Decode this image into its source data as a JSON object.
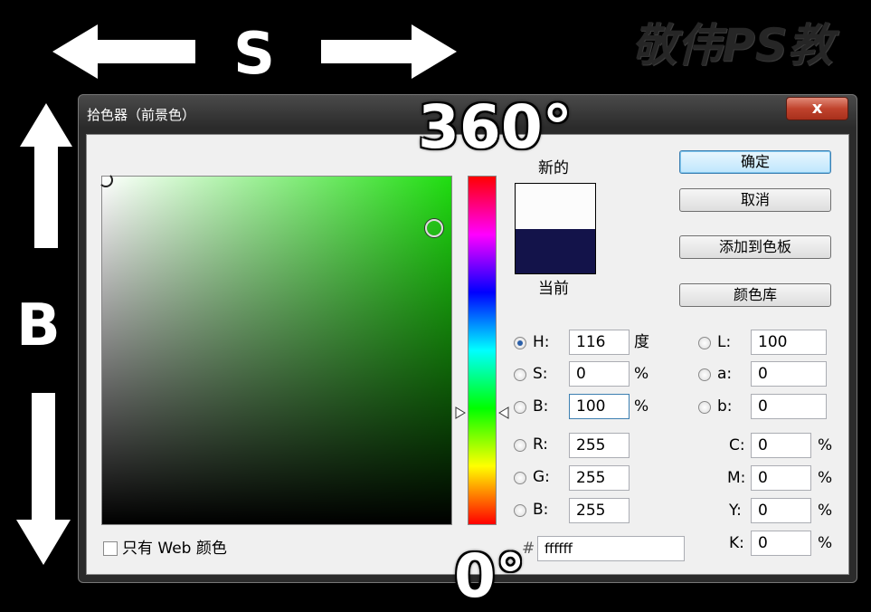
{
  "overlay": {
    "s_label": "S",
    "b_label": "B",
    "hue_top_label": "360°",
    "hue_bottom_label": "0°",
    "watermark": "敬伟PS教"
  },
  "dialog": {
    "title": "拾色器（前景色）",
    "close_label": "x"
  },
  "swatch": {
    "new_label": "新的",
    "current_label": "当前",
    "new_color": "#fcfcfc",
    "current_color": "#13134a"
  },
  "buttons": {
    "ok": "确定",
    "cancel": "取消",
    "add_to_swatches": "添加到色板",
    "color_libraries": "颜色库"
  },
  "hsb": {
    "h": {
      "label": "H:",
      "value": "116",
      "unit": "度",
      "selected": true
    },
    "s": {
      "label": "S:",
      "value": "0",
      "unit": "%"
    },
    "b": {
      "label": "B:",
      "value": "100",
      "unit": "%"
    }
  },
  "rgb": {
    "r": {
      "label": "R:",
      "value": "255"
    },
    "g": {
      "label": "G:",
      "value": "255"
    },
    "b": {
      "label": "B:",
      "value": "255"
    }
  },
  "lab": {
    "l": {
      "label": "L:",
      "value": "100"
    },
    "a": {
      "label": "a:",
      "value": "0"
    },
    "b": {
      "label": "b:",
      "value": "0"
    }
  },
  "cmyk": {
    "c": {
      "label": "C:",
      "value": "0",
      "unit": "%"
    },
    "m": {
      "label": "M:",
      "value": "0",
      "unit": "%"
    },
    "y": {
      "label": "Y:",
      "value": "0",
      "unit": "%"
    },
    "k": {
      "label": "K:",
      "value": "0",
      "unit": "%"
    }
  },
  "hex": {
    "label": "#",
    "value": "ffffff"
  },
  "web_only": {
    "label": "只有 Web 颜色",
    "checked": false
  },
  "colors": {
    "field_hue": "#1fdd10",
    "ok_border": "#3c7fb1",
    "close_red": "#c0432d"
  }
}
